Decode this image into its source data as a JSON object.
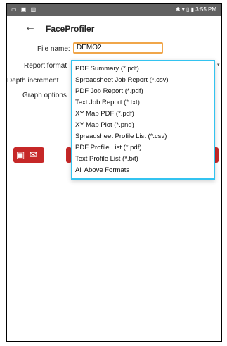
{
  "status_bar": {
    "left_icons": "▭ ▣ ▥",
    "right": "✱ ▾ ▯ ▮ 3:55 PM"
  },
  "app": {
    "title": "FaceProfiler",
    "back_icon": "arrow-back-icon"
  },
  "form": {
    "file_name_label": "File name:",
    "file_name_value": "DEMO2",
    "report_format_label": "Report format",
    "depth_increment_label": "Depth increment",
    "graph_options_label": "Graph options"
  },
  "dropdown": {
    "items": [
      "PDF Summary (*.pdf)",
      "Spreadsheet Job Report (*.csv)",
      "PDF Job Report (*.pdf)",
      "Text Job Report (*.txt)",
      "XY Map PDF (*.pdf)",
      "XY Map Plot (*.png)",
      "Spreadsheet Profile List (*.csv)",
      "PDF Profile List (*.pdf)",
      "Text Profile List (*.txt)",
      "All Above Formats"
    ]
  },
  "colors": {
    "accent_border": "#33c3f0",
    "input_border": "#f0a64a",
    "button_red": "#c62828"
  }
}
